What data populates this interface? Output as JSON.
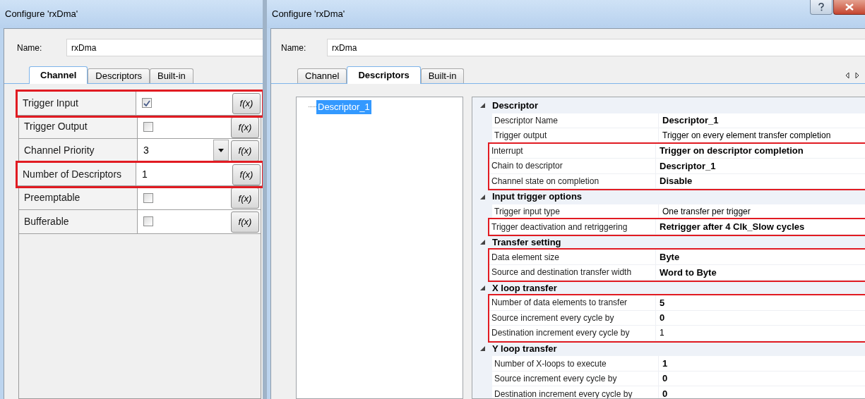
{
  "left_dialog": {
    "title": "Configure 'rxDma'",
    "name_label": "Name:",
    "name_value": "rxDma",
    "tabs": [
      {
        "label": "Channel",
        "selected": true
      },
      {
        "label": "Descriptors",
        "selected": false
      },
      {
        "label": "Built-in",
        "selected": false
      }
    ],
    "grid": {
      "rows": [
        {
          "kind": "checkbox",
          "label": "Trigger Input",
          "checked": true,
          "formula": "f(x)",
          "highlighted": true
        },
        {
          "kind": "checkbox",
          "label": "Trigger Output",
          "checked": false,
          "formula": "f(x)",
          "highlighted": false
        },
        {
          "kind": "dropdown",
          "label": "Channel Priority",
          "value": "3",
          "formula": "f(x)",
          "highlighted": false
        },
        {
          "kind": "text",
          "label": "Number of Descriptors",
          "value": "1",
          "formula": "f(x)",
          "highlighted": true
        },
        {
          "kind": "checkbox",
          "label": "Preemptable",
          "checked": false,
          "formula": "f(x)",
          "highlighted": false
        },
        {
          "kind": "checkbox",
          "label": "Bufferable",
          "checked": false,
          "formula": "f(x)",
          "highlighted": false
        }
      ]
    }
  },
  "right_dialog": {
    "title": "Configure 'rxDma'",
    "name_label": "Name:",
    "name_value": "rxDma",
    "tabs": [
      {
        "label": "Channel",
        "selected": false
      },
      {
        "label": "Descriptors",
        "selected": true
      },
      {
        "label": "Built-in",
        "selected": false
      }
    ],
    "tree": {
      "items": [
        {
          "label": "Descriptor_1",
          "selected": true
        }
      ]
    },
    "property_grid": {
      "categories": [
        {
          "title": "Descriptor",
          "expanded": true,
          "rows": [
            {
              "label": "Descriptor Name",
              "value": "Descriptor_1",
              "bold": true,
              "highlighted": false
            },
            {
              "label": "Trigger output",
              "value": "Trigger on every element transfer completion",
              "bold": false,
              "highlighted": false
            },
            {
              "label": "Interrupt",
              "value": "Trigger on descriptor completion",
              "bold": true,
              "highlighted": true
            },
            {
              "label": "Chain to descriptor",
              "value": "Descriptor_1",
              "bold": true,
              "highlighted": true
            },
            {
              "label": "Channel state on completion",
              "value": "Disable",
              "bold": true,
              "highlighted": true
            }
          ]
        },
        {
          "title": "Input trigger options",
          "expanded": true,
          "rows": [
            {
              "label": "Trigger input type",
              "value": "One transfer per trigger",
              "bold": false,
              "highlighted": false
            },
            {
              "label": "Trigger deactivation and retriggering",
              "value": "Retrigger after 4 Clk_Slow cycles",
              "bold": true,
              "highlighted": true
            }
          ]
        },
        {
          "title": "Transfer setting",
          "expanded": true,
          "rows": [
            {
              "label": "Data element size",
              "value": "Byte",
              "bold": true,
              "highlighted": true
            },
            {
              "label": "Source and destination transfer width",
              "value": "Word to Byte",
              "bold": true,
              "highlighted": true
            }
          ]
        },
        {
          "title": "X loop transfer",
          "expanded": true,
          "rows": [
            {
              "label": "Number of data elements to transfer",
              "value": "5",
              "bold": true,
              "highlighted": true
            },
            {
              "label": "Source increment every cycle by",
              "value": "0",
              "bold": true,
              "highlighted": true
            },
            {
              "label": "Destination increment every cycle by",
              "value": "1",
              "bold": false,
              "highlighted": true
            }
          ]
        },
        {
          "title": "Y loop transfer",
          "expanded": true,
          "rows": [
            {
              "label": "Number of X-loops to execute",
              "value": "1",
              "bold": true,
              "highlighted": false
            },
            {
              "label": "Source increment every cycle by",
              "value": "0",
              "bold": true,
              "highlighted": false
            },
            {
              "label": "Destination increment every cycle by",
              "value": "0",
              "bold": true,
              "highlighted": false
            }
          ]
        }
      ]
    }
  }
}
